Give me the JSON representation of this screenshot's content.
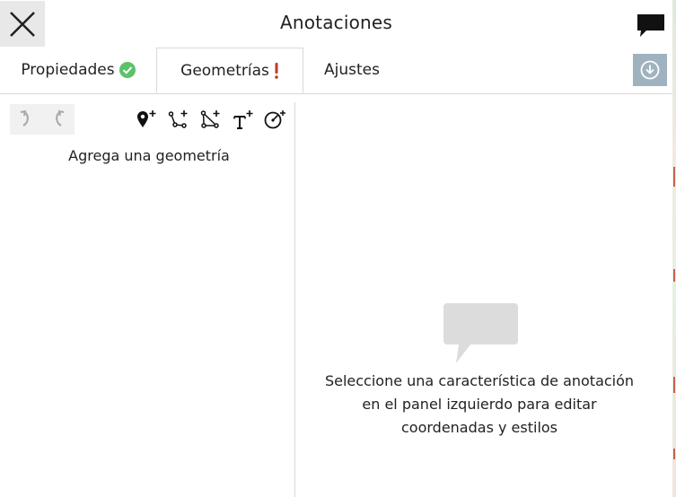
{
  "header": {
    "title": "Anotaciones",
    "close_icon": "close-icon",
    "chat_icon": "speech-bubble-icon"
  },
  "tabs": [
    {
      "label": "Propiedades",
      "status_icon": "check-circle-icon",
      "status_color": "#5cc26a"
    },
    {
      "label": "Geometrías",
      "status_icon": "exclamation-icon",
      "status_color": "#c0392b",
      "active": true
    },
    {
      "label": "Ajustes"
    }
  ],
  "download_icon": "download-circle-icon",
  "toolbar": {
    "undo_icon": "undo-icon",
    "redo_icon": "redo-icon",
    "tools": [
      "add-point-icon",
      "add-line-icon",
      "add-polygon-icon",
      "add-text-icon",
      "add-circle-icon"
    ]
  },
  "left_panel": {
    "empty_message": "Agrega una geometría"
  },
  "right_panel": {
    "placeholder_icon": "speech-bubble-icon",
    "hint_lines": [
      "Seleccione una característica de anotación",
      "en el panel izquierdo para editar",
      "coordenadas y estilos"
    ]
  },
  "colors": {
    "accent_download": "#9fb2bf",
    "success": "#5cc26a",
    "warning": "#c0392b"
  }
}
